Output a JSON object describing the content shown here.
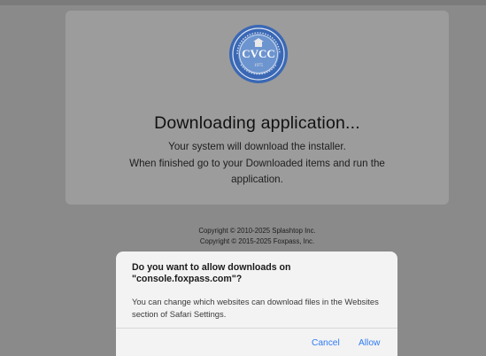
{
  "page": {
    "title": "Downloading application...",
    "subtitle_line1": "Your system will download the installer.",
    "subtitle_line2": "When finished go to your Downloaded items and run the application.",
    "logo": {
      "icon": "cvcc-seal-icon",
      "text": "CVCC",
      "colors": {
        "ring": "#3a68b5",
        "inner": "#6c94cf"
      }
    }
  },
  "footer": {
    "copyright1": "Copyright © 2010-2025 Splashtop Inc.",
    "copyright2": "Copyright © 2015-2025 Foxpass, Inc."
  },
  "dialog": {
    "title": "Do you want to allow downloads on \"console.foxpass.com\"?",
    "message": "You can change which websites can download files in the Websites section of Safari Settings.",
    "cancel_label": "Cancel",
    "allow_label": "Allow",
    "accent": "#2f7bf5"
  }
}
